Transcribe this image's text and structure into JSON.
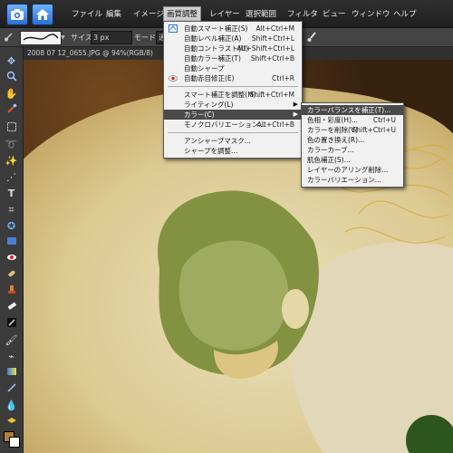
{
  "menubar": {
    "items": [
      "ファイル",
      "編集",
      "イメージ",
      "画質調整",
      "レイヤー",
      "選択範囲",
      "フィルタ",
      "ビュー",
      "ウィンドウ",
      "ヘルプ"
    ],
    "active_index": 3
  },
  "options": {
    "size_label": "サイズ:",
    "size_value": "3 px",
    "mode_label": "モード",
    "mode_value": "通"
  },
  "document": {
    "title": "2008 07 12_0655.JPG @ 94%(RGB/8)"
  },
  "main_menu": {
    "items": [
      {
        "label": "自動スマート補正(S)",
        "shortcut": "Alt+Ctrl+M",
        "icon": "smart-fix-icon"
      },
      {
        "label": "自動レベル補正(A)",
        "shortcut": "Shift+Ctrl+L"
      },
      {
        "label": "自動コントラスト(U)",
        "shortcut": "Alt+Shift+Ctrl+L"
      },
      {
        "label": "自動カラー補正(T)",
        "shortcut": "Shift+Ctrl+B"
      },
      {
        "label": "自動シャープ",
        "shortcut": ""
      },
      {
        "label": "自動赤目修正(E)",
        "shortcut": "Ctrl+R",
        "icon": "red-eye-icon"
      },
      {
        "label": "スマート補正を調整(M)...",
        "shortcut": "Shift+Ctrl+M"
      },
      {
        "label": "ライティング(L)",
        "shortcut": "",
        "submenu": true
      },
      {
        "label": "カラー(C)",
        "shortcut": "",
        "submenu": true,
        "highlighted": true
      },
      {
        "label": "モノクロバリエーション...",
        "shortcut": "Alt+Ctrl+B"
      },
      {
        "label": "アンシャープマスク...",
        "shortcut": ""
      },
      {
        "label": "シャープを調整...",
        "shortcut": ""
      }
    ]
  },
  "color_submenu": {
    "items": [
      {
        "label": "カラーバランスを補正(T)...",
        "shortcut": "",
        "highlighted": true
      },
      {
        "label": "色相・彩度(H)...",
        "shortcut": "Ctrl+U"
      },
      {
        "label": "カラーを削除(V)",
        "shortcut": "Shift+Ctrl+U"
      },
      {
        "label": "色の置き換え(R)...",
        "shortcut": ""
      },
      {
        "label": "カラーカーブ...",
        "shortcut": ""
      },
      {
        "label": "肌色補正(S)...",
        "shortcut": ""
      },
      {
        "label": "レイヤーのアリング削除...",
        "shortcut": ""
      },
      {
        "label": "カラーバリエーション...",
        "shortcut": ""
      }
    ]
  },
  "colors": {
    "menu_highlight": "#4a4a4a",
    "menubar_bg": "#252525",
    "toolbox_bg": "#3b3b3b"
  }
}
